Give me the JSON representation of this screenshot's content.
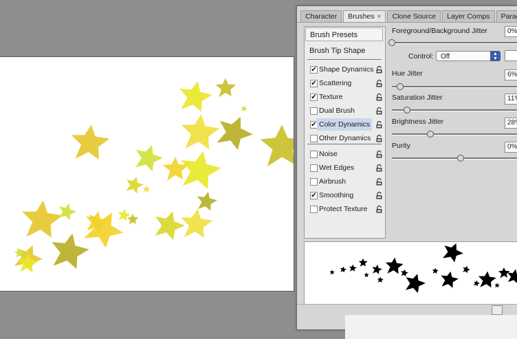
{
  "tabs": [
    {
      "label": "Character",
      "active": false
    },
    {
      "label": "Brushes",
      "active": true
    },
    {
      "label": "Clone Source",
      "active": false
    },
    {
      "label": "Layer Comps",
      "active": false
    },
    {
      "label": "Paragraph",
      "active": false
    }
  ],
  "close_glyph": "×",
  "brush_presets_label": "Brush Presets",
  "brush_tip_shape_label": "Brush Tip Shape",
  "options": [
    {
      "label": "Shape Dynamics",
      "checked": true
    },
    {
      "label": "Scattering",
      "checked": true
    },
    {
      "label": "Texture",
      "checked": true
    },
    {
      "label": "Dual Brush",
      "checked": false
    },
    {
      "label": "Color Dynamics",
      "checked": true,
      "highlighted": true
    },
    {
      "label": "Other Dynamics",
      "checked": false
    },
    {
      "label": "Noise",
      "checked": false
    },
    {
      "label": "Wet Edges",
      "checked": false
    },
    {
      "label": "Airbrush",
      "checked": false
    },
    {
      "label": "Smoothing",
      "checked": true
    },
    {
      "label": "Protect Texture",
      "checked": false
    }
  ],
  "settings": {
    "fg_bg_jitter": {
      "label": "Foreground/Background Jitter",
      "value": "0%",
      "level": 0
    },
    "control": {
      "label": "Control:",
      "value": "Off"
    },
    "hue_jitter": {
      "label": "Hue Jitter",
      "value": "6%",
      "level": 6
    },
    "saturation_jitter": {
      "label": "Saturation Jitter",
      "value": "11%",
      "level": 11
    },
    "brightness_jitter": {
      "label": "Brightness Jitter",
      "value": "28%",
      "level": 28
    },
    "purity": {
      "label": "Purity",
      "value": "0%",
      "level": 0,
      "min": -100,
      "max": 100
    }
  },
  "check_glyph": "✔",
  "colors": {
    "star_palette": [
      "#e8e82a",
      "#c9c02a",
      "#d8d830",
      "#f0e040",
      "#b8b028",
      "#e6c830",
      "#d0e23a",
      "#f2d22a"
    ]
  }
}
